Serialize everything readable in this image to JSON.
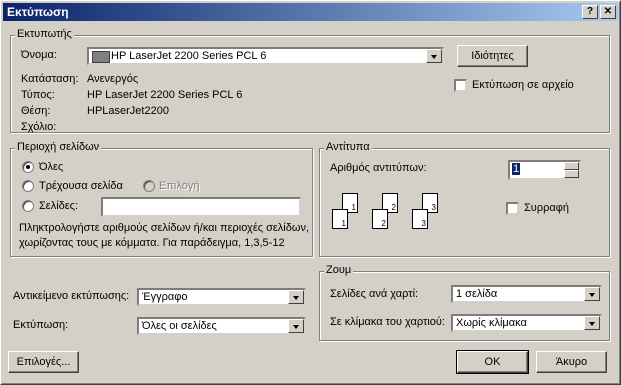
{
  "window": {
    "title": "Εκτύπωση",
    "help_label": "?",
    "close_label": "✕"
  },
  "printer": {
    "group_label": "Εκτυπωτής",
    "name_label": "Όνομα:",
    "name_value": "HP LaserJet 2200 Series PCL 6",
    "properties_button": "Ιδιότητες",
    "status_label": "Κατάσταση:",
    "status_value": "Ανενεργός",
    "type_label": "Τύπος:",
    "type_value": "HP LaserJet 2200 Series PCL 6",
    "location_label": "Θέση:",
    "location_value": "HPLaserJet2200",
    "comment_label": "Σχόλιο:",
    "print_to_file_label": "Εκτύπωση σε αρχείο"
  },
  "page_range": {
    "group_label": "Περιοχή σελίδων",
    "all_label": "Όλες",
    "current_label": "Τρέχουσα σελίδα",
    "selection_label": "Επιλογή",
    "pages_label": "Σελίδες:",
    "pages_value": "",
    "help_text_1": "Πληκτρολογήστε αριθμούς σελίδων ή/και περιοχές σελίδων,",
    "help_text_2": "χωρίζοντας τους με κόμματα. Για παράδειγμα, 1,3,5-12"
  },
  "copies": {
    "group_label": "Αντίτυπα",
    "count_label": "Αριθμός αντιτύπων:",
    "count_value": "1",
    "collate_label": "Συρραφή",
    "page_numbers": [
      "1",
      "2",
      "3"
    ]
  },
  "print_what": {
    "label": "Αντικείμενο εκτύπωσης:",
    "value": "Έγγραφο"
  },
  "print": {
    "label": "Εκτύπωση:",
    "value": "Όλες οι σελίδες"
  },
  "zoom": {
    "group_label": "Ζουμ",
    "pages_per_sheet_label": "Σελίδες ανά χαρτί:",
    "pages_per_sheet_value": "1 σελίδα",
    "scale_label": "Σε κλίμακα του χαρτιού:",
    "scale_value": "Χωρίς κλίμακα"
  },
  "buttons": {
    "options": "Επιλογές...",
    "ok": "OK",
    "cancel": "Άκυρο"
  }
}
